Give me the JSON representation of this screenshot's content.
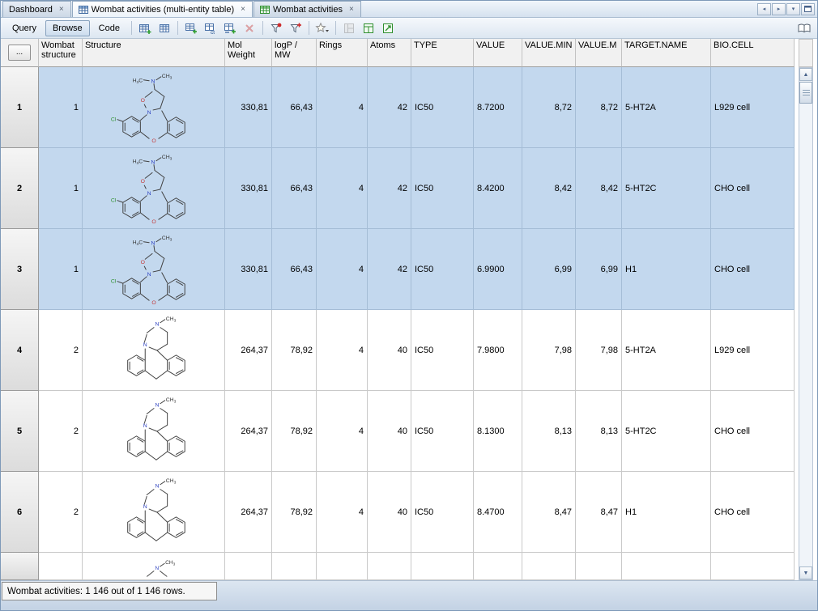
{
  "tabs": {
    "items": [
      {
        "label": "Dashboard",
        "icon": null,
        "active": false
      },
      {
        "label": "Wombat activities (multi-entity table)",
        "icon": "table-grid-blue-icon",
        "active": true
      },
      {
        "label": "Wombat activities",
        "icon": "table-grid-green-icon",
        "active": false
      }
    ],
    "controls": [
      "scroll-tabs-left-icon",
      "scroll-tabs-right-icon",
      "tab-list-dropdown-icon",
      "maximize-window-icon"
    ]
  },
  "toolbar": {
    "modes": [
      {
        "label": "Query",
        "active": false
      },
      {
        "label": "Browse",
        "active": true
      },
      {
        "label": "Code",
        "active": false
      }
    ],
    "icons": [
      "new-table-icon",
      "show-table-icon",
      "add-row-icon",
      "table-ct-icon",
      "table-append-icon",
      "delete-row-icon",
      "filter-icon",
      "add-filter-icon",
      "favorites-star-icon",
      "form-view-icon",
      "grid-view-icon",
      "fit-view-icon",
      "open-book-icon"
    ]
  },
  "table": {
    "corner_button_label": "...",
    "columns": [
      {
        "label": "Wombat structure"
      },
      {
        "label": "Structure"
      },
      {
        "label": "Mol Weight"
      },
      {
        "label": "logP / MW"
      },
      {
        "label": "Rings"
      },
      {
        "label": "Atoms"
      },
      {
        "label": "TYPE"
      },
      {
        "label": "VALUE"
      },
      {
        "label": "VALUE.MIN"
      },
      {
        "label": "VALUE.M"
      },
      {
        "label": "TARGET.NAME"
      },
      {
        "label": "BIO.CELL"
      }
    ],
    "rows": [
      {
        "row_num": "1",
        "wombat_structure": "1",
        "structure_image": "chloro-dibenzoxepine-dimethylamino-molecule",
        "mol_weight": "330,81",
        "logp_mw": "66,43",
        "rings": "4",
        "atoms": "42",
        "type": "IC50",
        "value": "8.7200",
        "value_min": "8,72",
        "value_max": "8,72",
        "target_name": "5-HT2A",
        "bio_cell": "L929 cell",
        "selected": true
      },
      {
        "row_num": "2",
        "wombat_structure": "1",
        "structure_image": "chloro-dibenzoxepine-dimethylamino-molecule",
        "mol_weight": "330,81",
        "logp_mw": "66,43",
        "rings": "4",
        "atoms": "42",
        "type": "IC50",
        "value": "8.4200",
        "value_min": "8,42",
        "value_max": "8,42",
        "target_name": "5-HT2C",
        "bio_cell": "CHO cell",
        "selected": true
      },
      {
        "row_num": "3",
        "wombat_structure": "1",
        "structure_image": "chloro-dibenzoxepine-dimethylamino-molecule",
        "mol_weight": "330,81",
        "logp_mw": "66,43",
        "rings": "4",
        "atoms": "42",
        "type": "IC50",
        "value": "6.9900",
        "value_min": "6,99",
        "value_max": "6,99",
        "target_name": "H1",
        "bio_cell": "CHO cell",
        "selected": true
      },
      {
        "row_num": "4",
        "wombat_structure": "2",
        "structure_image": "n-methylpiperazino-tricyclic-molecule",
        "mol_weight": "264,37",
        "logp_mw": "78,92",
        "rings": "4",
        "atoms": "40",
        "type": "IC50",
        "value": "7.9800",
        "value_min": "7,98",
        "value_max": "7,98",
        "target_name": "5-HT2A",
        "bio_cell": "L929 cell",
        "selected": false
      },
      {
        "row_num": "5",
        "wombat_structure": "2",
        "structure_image": "n-methylpiperazino-tricyclic-molecule",
        "mol_weight": "264,37",
        "logp_mw": "78,92",
        "rings": "4",
        "atoms": "40",
        "type": "IC50",
        "value": "8.1300",
        "value_min": "8,13",
        "value_max": "8,13",
        "target_name": "5-HT2C",
        "bio_cell": "CHO cell",
        "selected": false
      },
      {
        "row_num": "6",
        "wombat_structure": "2",
        "structure_image": "n-methylpiperazino-tricyclic-molecule",
        "mol_weight": "264,37",
        "logp_mw": "78,92",
        "rings": "4",
        "atoms": "40",
        "type": "IC50",
        "value": "8.4700",
        "value_min": "8,47",
        "value_max": "8,47",
        "target_name": "H1",
        "bio_cell": "CHO cell",
        "selected": false
      }
    ],
    "partial_row": {
      "structure_image": "n-methylpiperazino-tricyclic-molecule-top-edge"
    }
  },
  "status_bar": {
    "text": "Wombat activities: 1 146 out of 1 146 rows."
  }
}
